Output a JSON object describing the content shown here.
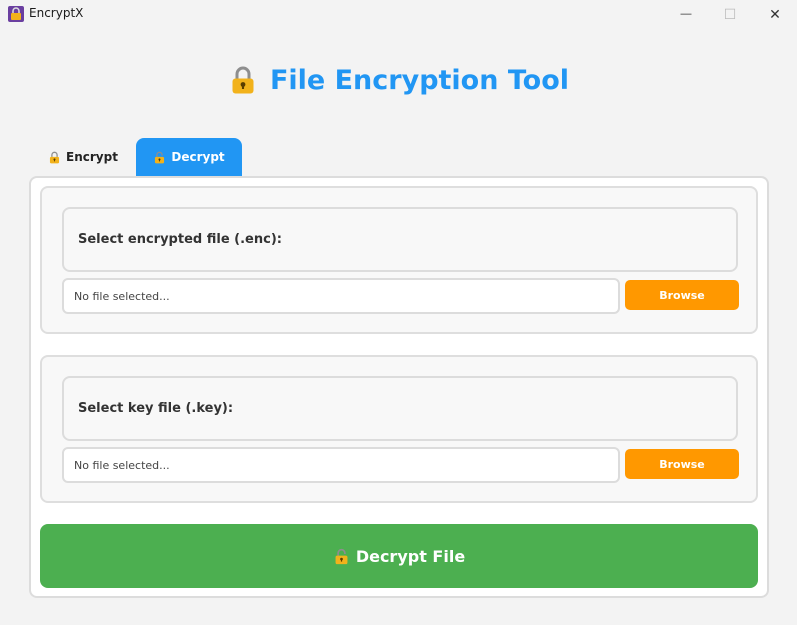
{
  "window": {
    "title": "EncryptX",
    "minimize_glyph": "—",
    "maximize_glyph": "☐",
    "close_glyph": "✕"
  },
  "header": {
    "icon": "lock-icon",
    "title": "File Encryption Tool",
    "color": "#2196f3"
  },
  "tabs": [
    {
      "label": "Encrypt",
      "icon": "lock-icon",
      "active": false
    },
    {
      "label": "Decrypt",
      "icon": "unlock-icon",
      "active": true
    }
  ],
  "decrypt_panel": {
    "encrypted_file": {
      "label": "Select encrypted file (.enc):",
      "value": "No file selected...",
      "browse_label": "Browse"
    },
    "key_file": {
      "label": "Select key file (.key):",
      "value": "No file selected...",
      "browse_label": "Browse"
    },
    "action_button": {
      "icon": "unlock-icon",
      "label": "Decrypt File",
      "color": "#4caf50"
    }
  },
  "colors": {
    "tab_active": "#2196f3",
    "browse": "#ff9800",
    "action": "#4caf50"
  }
}
